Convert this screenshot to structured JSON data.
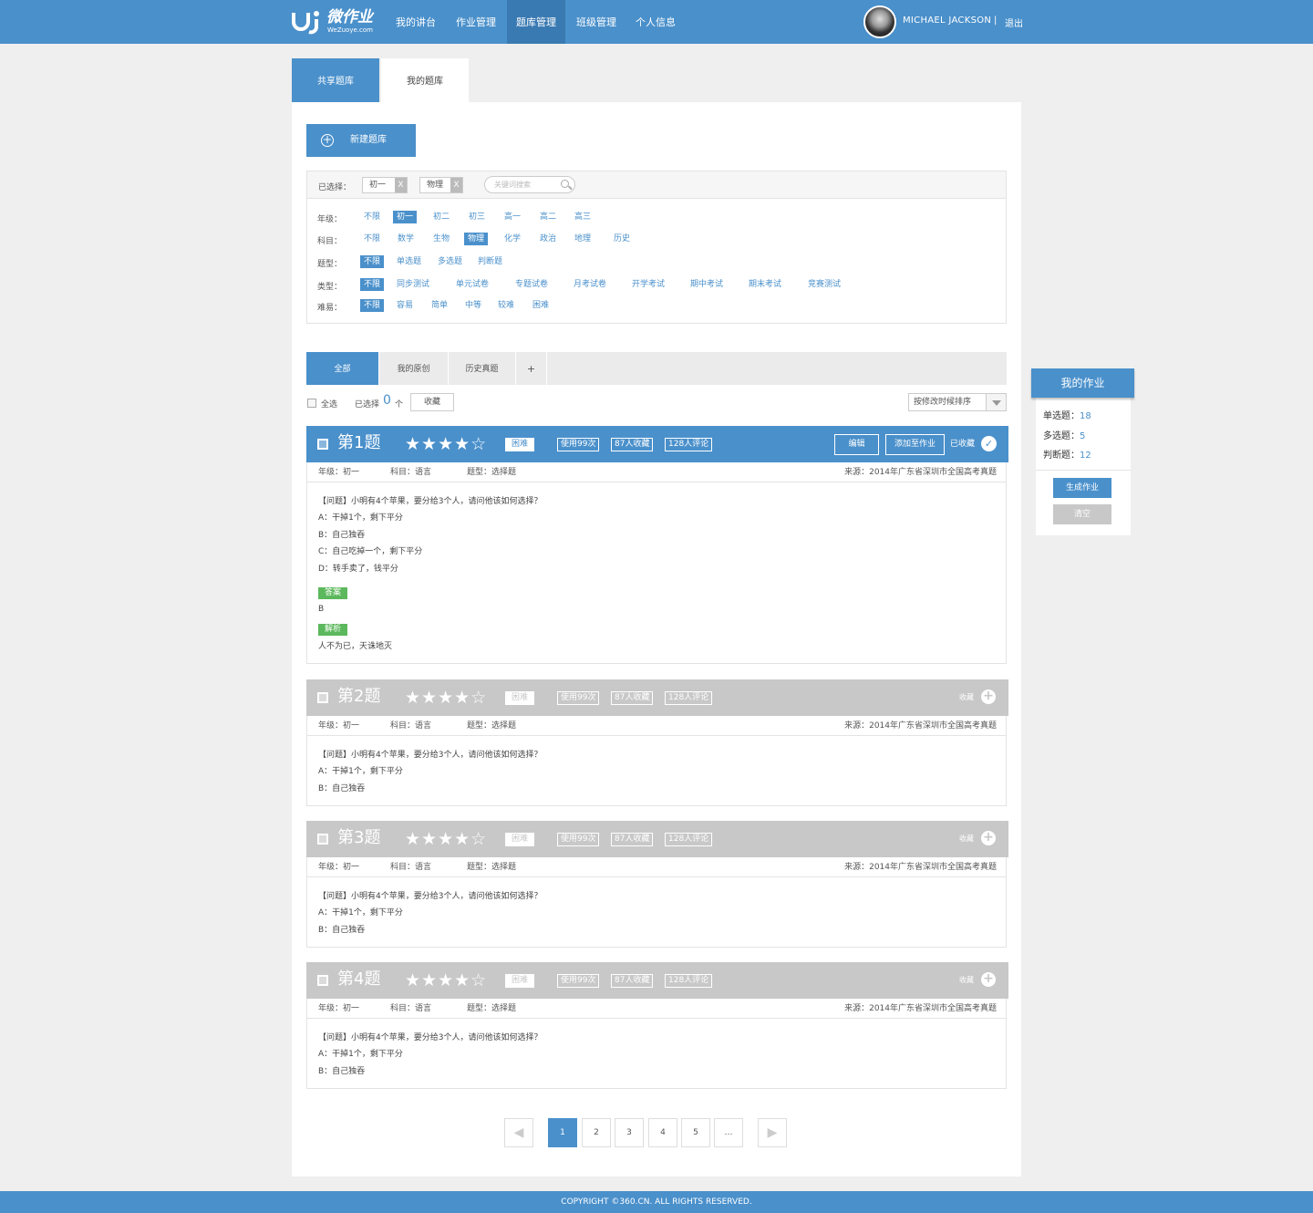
{
  "brand": {
    "name": "微作业",
    "sub": "WeZuoye.com"
  },
  "nav": [
    "我的讲台",
    "作业管理",
    "题库管理",
    "班级管理",
    "个人信息"
  ],
  "nav_active": 2,
  "user": {
    "name": "MICHAEL JACKSON",
    "separator": "|",
    "logout": "退出"
  },
  "lib_tabs": [
    "共享题库",
    "我的题库"
  ],
  "new_bank": {
    "icon": "plus-circle-icon",
    "label": "新建题库"
  },
  "filter": {
    "selected_label": "已选择：",
    "chips": [
      "初一",
      "物理"
    ],
    "chip_remove": "X",
    "search_placeholder": "关键词搜索",
    "rows": [
      {
        "label": "年级：",
        "options": [
          "不限",
          "初一",
          "初二",
          "初三",
          "高一",
          "高二",
          "高三"
        ],
        "selected": 1
      },
      {
        "label": "科目：",
        "options": [
          "不限",
          "数学",
          "生物",
          "物理",
          "化学",
          "政治",
          "地理",
          "历史"
        ],
        "selected": 3
      },
      {
        "label": "题型：",
        "options": [
          "不限",
          "单选题",
          "多选题",
          "判断题"
        ],
        "selected": 0
      },
      {
        "label": "类型：",
        "options": [
          "不限",
          "同步测试",
          "单元试卷",
          "专题试卷",
          "月考试卷",
          "开学考试",
          "期中考试",
          "期末考试",
          "竞赛测试"
        ],
        "selected": 0
      },
      {
        "label": "难易：",
        "options": [
          "不限",
          "容易",
          "简单",
          "中等",
          "较难",
          "困难"
        ],
        "selected": 0
      }
    ]
  },
  "list_tabs": [
    "全部",
    "我的原创",
    "历史真题",
    "+"
  ],
  "selection": {
    "select_all": "全选",
    "selected_prefix": "已选择",
    "count": "0",
    "unit": "个",
    "collect": "收藏",
    "sort": "按修改时候排序"
  },
  "questions": [
    {
      "title": "第1题",
      "stars": "★★★★☆",
      "difficulty": "困难",
      "tags": [
        "使用99次",
        "87人收藏",
        "128人评论"
      ],
      "edit": "编辑",
      "add": "添加至作业",
      "collected": "已收藏",
      "meta": {
        "grade": "年级：初一",
        "subject": "科目：语言",
        "type": "题型：选择题",
        "source": "来源：2014年广东省深圳市全国高考真题"
      },
      "lines": [
        "【问题】小明有4个苹果，要分给3个人，请问他该如何选择？",
        "A：干掉1个，剩下平分",
        "B：自己独吞",
        "C：自己吃掉一个，剩下平分",
        "D：转手卖了，钱平分"
      ],
      "answer_label": "答案",
      "answer": "B",
      "analysis_label": "解析",
      "analysis": "人不为已，天诛地灭"
    },
    {
      "title": "第2题",
      "stars": "★★★★☆",
      "difficulty": "困难",
      "tags": [
        "使用99次",
        "87人收藏",
        "128人评论"
      ],
      "fav": "收藏",
      "meta": {
        "grade": "年级：初一",
        "subject": "科目：语言",
        "type": "题型：选择题",
        "source": "来源：2014年广东省深圳市全国高考真题"
      },
      "lines": [
        "【问题】小明有4个苹果，要分给3个人，请问他该如何选择？",
        "A：干掉1个，剩下平分",
        "B：自己独吞"
      ]
    },
    {
      "title": "第3题",
      "stars": "★★★★☆",
      "difficulty": "困难",
      "tags": [
        "使用99次",
        "87人收藏",
        "128人评论"
      ],
      "fav": "收藏",
      "meta": {
        "grade": "年级：初一",
        "subject": "科目：语言",
        "type": "题型：选择题",
        "source": "来源：2014年广东省深圳市全国高考真题"
      },
      "lines": [
        "【问题】小明有4个苹果，要分给3个人，请问他该如何选择？",
        "A：干掉1个，剩下平分",
        "B：自己独吞"
      ]
    },
    {
      "title": "第4题",
      "stars": "★★★★☆",
      "difficulty": "困难",
      "tags": [
        "使用99次",
        "87人收藏",
        "128人评论"
      ],
      "fav": "收藏",
      "meta": {
        "grade": "年级：初一",
        "subject": "科目：语言",
        "type": "题型：选择题",
        "source": "来源：2014年广东省深圳市全国高考真题"
      },
      "lines": [
        "【问题】小明有4个苹果，要分给3个人，请问他该如何选择？",
        "A：干掉1个，剩下平分",
        "B：自己独吞"
      ]
    }
  ],
  "pagination": {
    "prev": "◀",
    "pages": [
      "1",
      "2",
      "3",
      "4",
      "5",
      "…"
    ],
    "active": 0,
    "next": "▶"
  },
  "sidebar": {
    "title": "我的作业",
    "rows": [
      {
        "label": "单选题：",
        "value": "18"
      },
      {
        "label": "多选题：",
        "value": "5"
      },
      {
        "label": "判断题：",
        "value": "12"
      }
    ],
    "generate": "生成作业",
    "clear": "清空"
  },
  "footer": "COPYRIGHT ©360.CN. ALL RIGHTS RESERVED.",
  "colors": {
    "primary": "#4a90cb",
    "header_dark": "#3a7ab2",
    "grey_head": "#c8c8c8",
    "green": "#5cb85c",
    "bg": "#efefef"
  }
}
